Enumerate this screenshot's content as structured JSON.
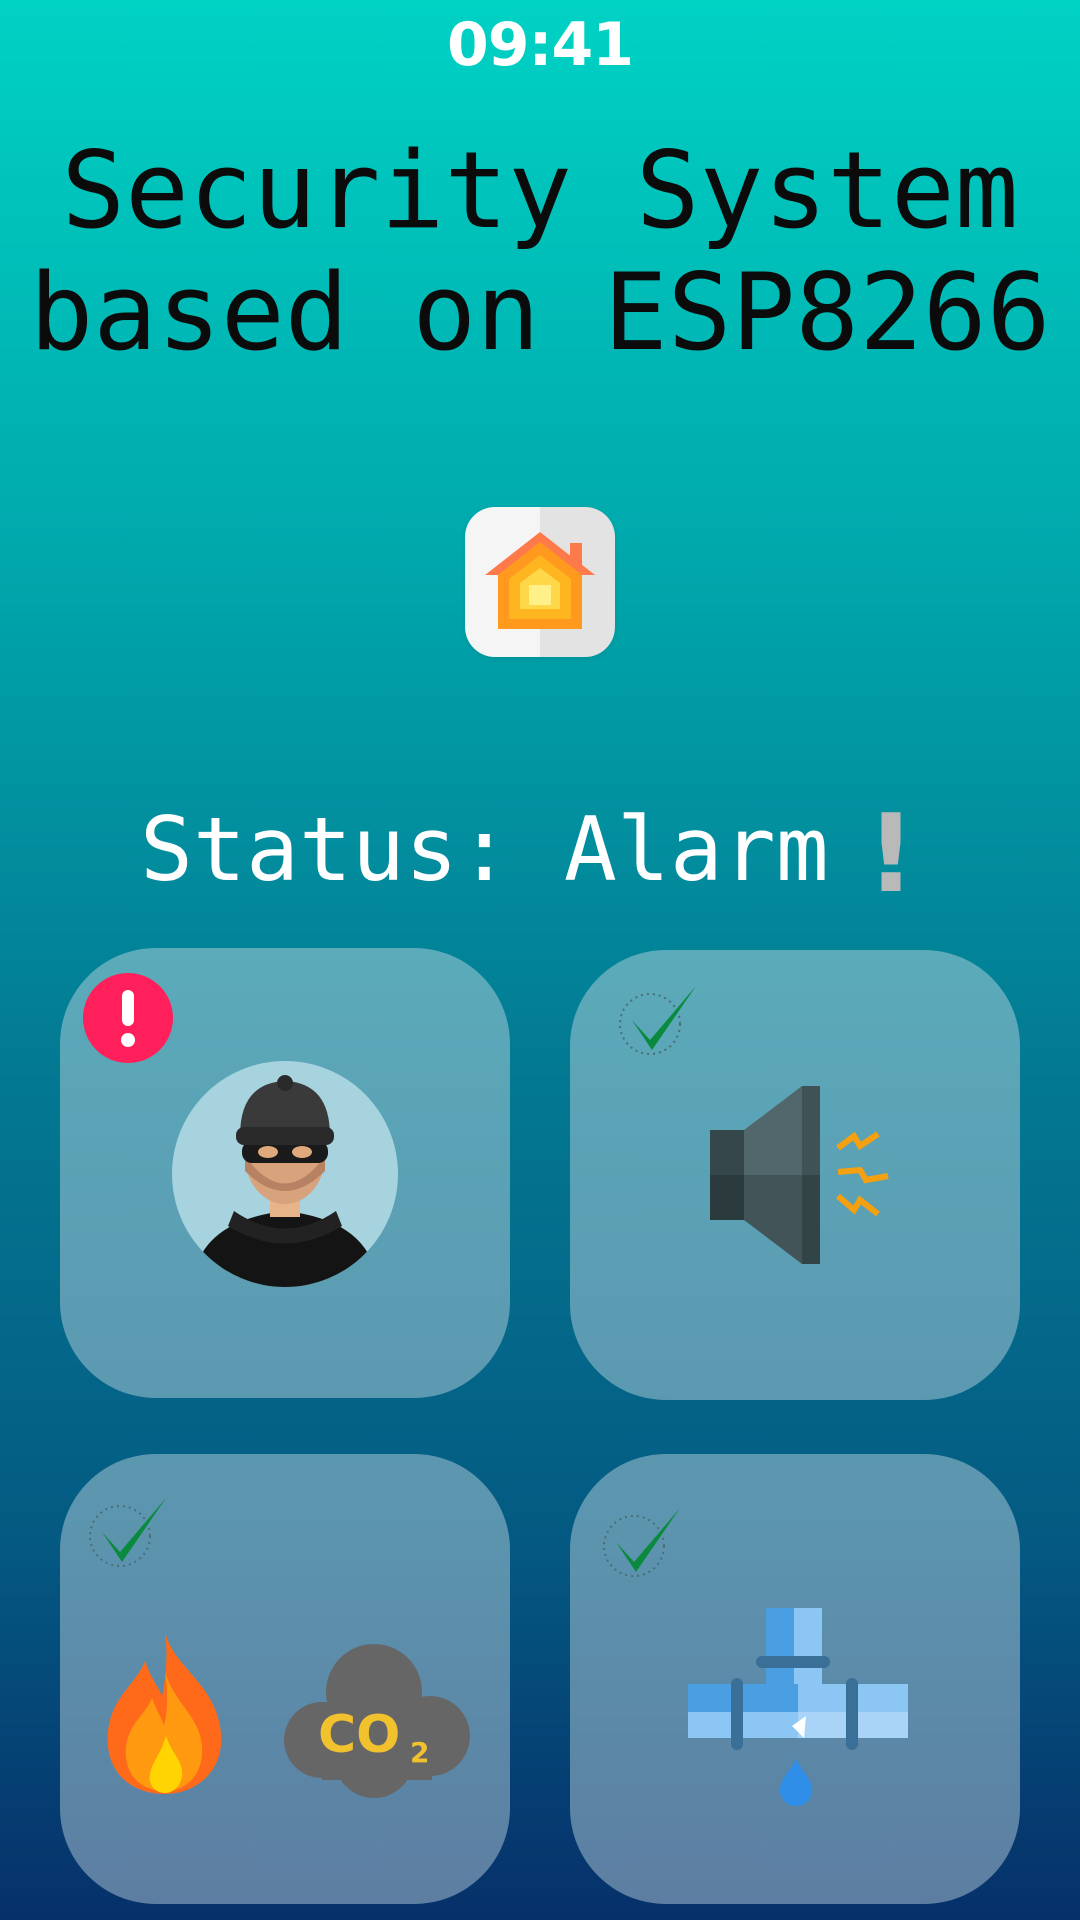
{
  "status_bar": {
    "time": "09:41"
  },
  "header": {
    "title": "Security System\nbased on ESP8266"
  },
  "app_icon": {
    "name": "home-icon",
    "colors": [
      "#ff7043",
      "#ff9800",
      "#ffc107",
      "#ffe066"
    ]
  },
  "status": {
    "label": "Status:",
    "value": "Alarm",
    "mark": "!"
  },
  "cards": [
    {
      "id": "intruder",
      "sensor_icon": "thief-icon",
      "state": "alarm",
      "state_icon": "alert-icon",
      "state_color": "#ff1f5a"
    },
    {
      "id": "siren",
      "sensor_icon": "speaker-icon",
      "state": "ok",
      "state_icon": "checkmark-icon",
      "state_color": "#0a8a3e"
    },
    {
      "id": "fire-gas",
      "sensor_icon": "fire-co2-icon",
      "state": "ok",
      "state_icon": "checkmark-icon",
      "state_color": "#0a8a3e",
      "co2_label": "CO",
      "co2_subscript": "2"
    },
    {
      "id": "water-leak",
      "sensor_icon": "pipe-leak-icon",
      "state": "ok",
      "state_icon": "checkmark-icon",
      "state_color": "#0a8a3e"
    }
  ]
}
